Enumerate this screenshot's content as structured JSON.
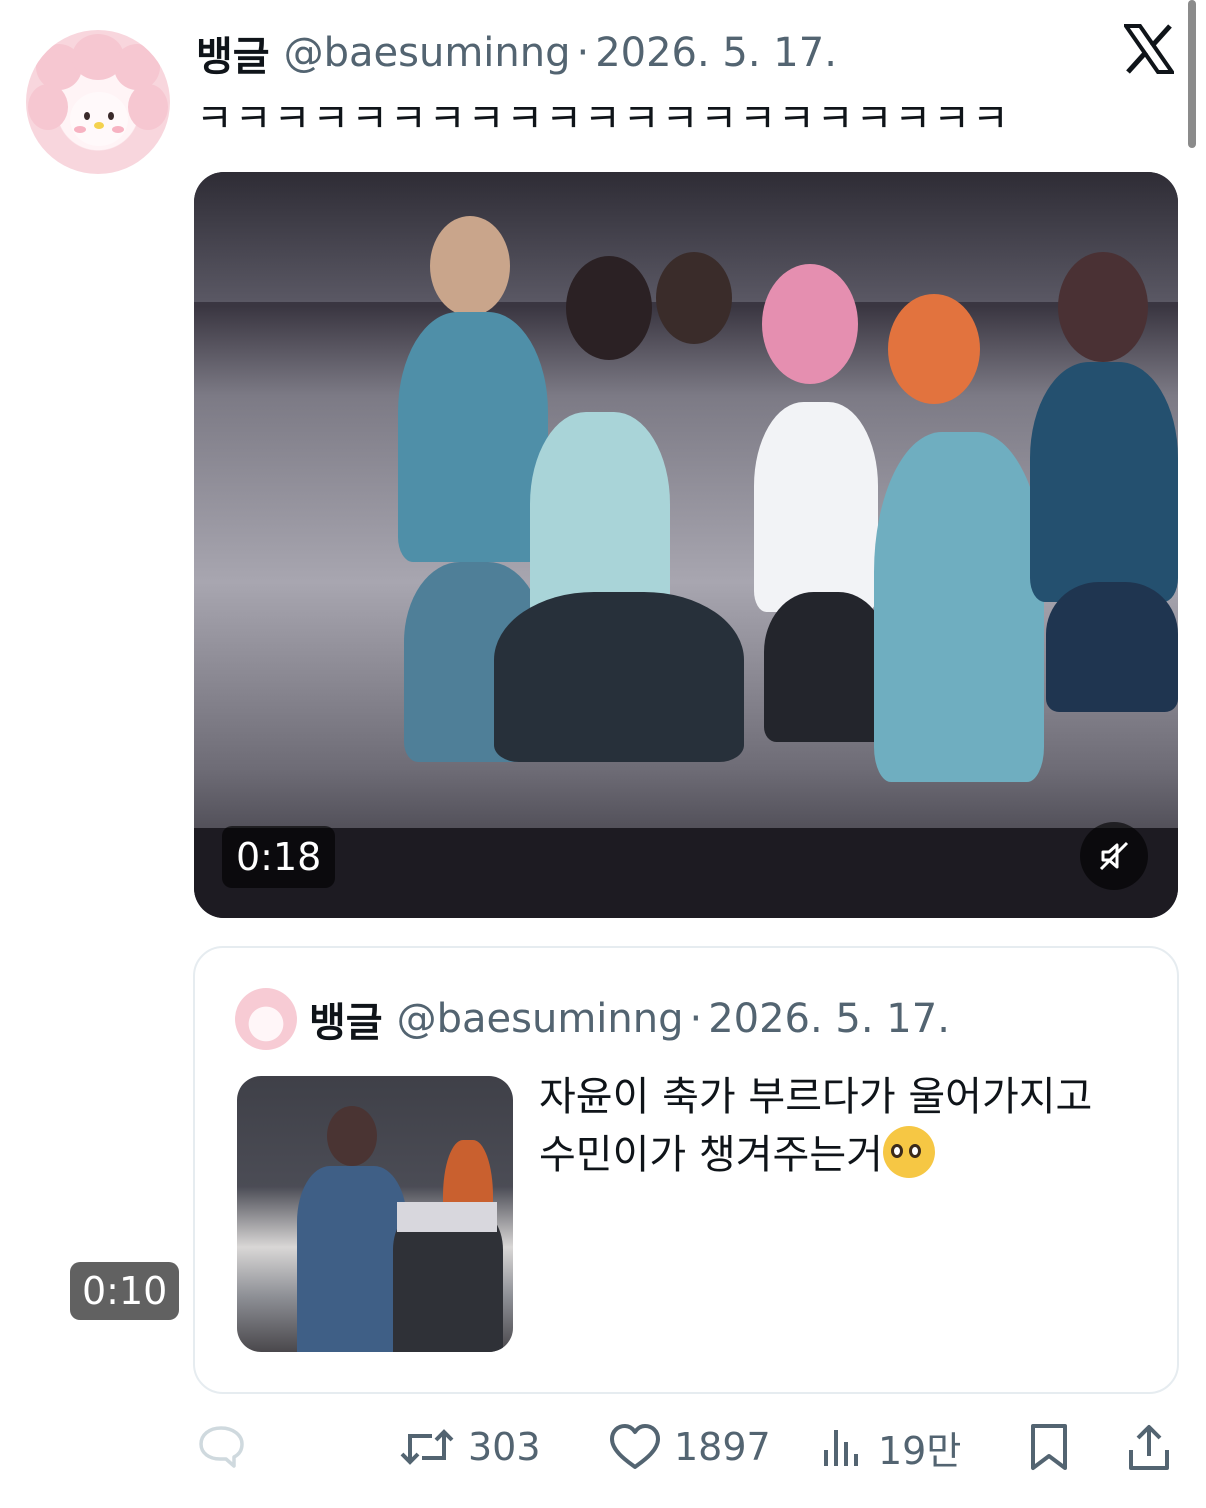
{
  "tweet": {
    "author_name": "뱅글",
    "handle": "@baesuminng",
    "separator": "·",
    "date": "2026. 5. 17.",
    "text": "ㅋㅋㅋㅋㅋㅋㅋㅋㅋㅋㅋㅋㅋㅋㅋㅋㅋㅋㅋㅋㅋ",
    "video_duration": "0:18",
    "video_muted": true
  },
  "quoted_tweet": {
    "author_name": "뱅글",
    "handle": "@baesuminng",
    "separator": "·",
    "date": "2026. 5. 17.",
    "text": "자윤이 축가 부르다가 울어가지고 수민이가 챙겨주는거",
    "emoji": "pleading-face",
    "video_duration": "0:10"
  },
  "actions": {
    "reply_count": "",
    "retweet_count": "303",
    "like_count": "1897",
    "view_count": "19만"
  },
  "icons": {
    "brand": "x-logo-icon",
    "mute": "muted-speaker-icon",
    "reply": "reply-icon",
    "retweet": "retweet-icon",
    "like": "heart-icon",
    "views": "views-icon",
    "bookmark": "bookmark-icon",
    "share": "share-icon"
  },
  "colors": {
    "text_primary": "#0f1419",
    "text_secondary": "#536471",
    "border": "#e6ecf0"
  }
}
